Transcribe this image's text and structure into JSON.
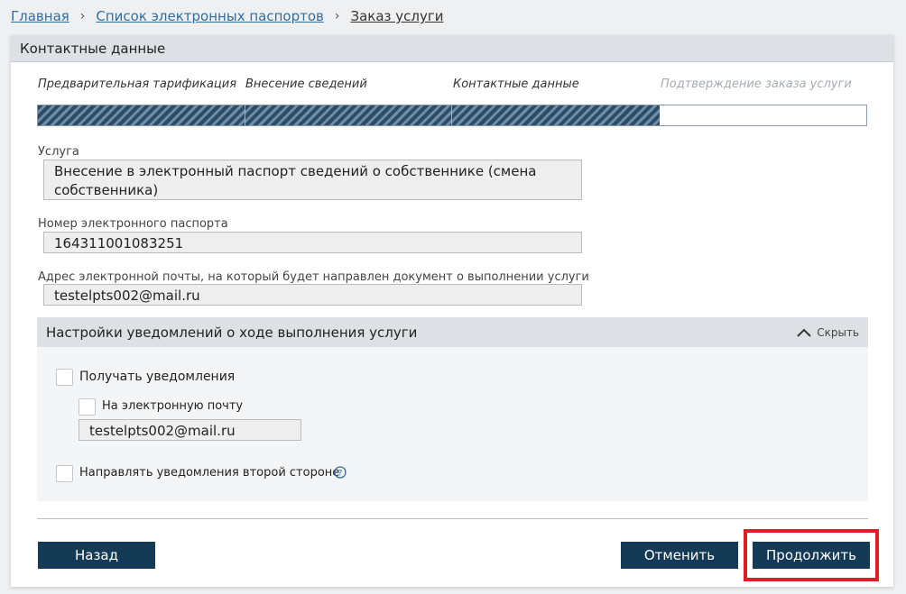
{
  "breadcrumb": {
    "home": "Главная",
    "passports": "Список электронных паспортов",
    "current": "Заказ услуги"
  },
  "panel": {
    "title": "Контактные данные"
  },
  "steps": [
    {
      "label": "Предварительная тарификация",
      "completed": true
    },
    {
      "label": "Внесение сведений",
      "completed": true
    },
    {
      "label": "Контактные данные",
      "completed": true
    },
    {
      "label": "Подтверждение заказа услуги",
      "completed": false
    }
  ],
  "form": {
    "service_label": "Услуга",
    "service_value": "Внесение в электронный паспорт сведений о собственнике (смена собственника)",
    "passport_label": "Номер электронного паспорта",
    "passport_value": "164311001083251",
    "email_label": "Адрес электронной почты, на который будет направлен документ о выполнении услуги",
    "email_value": "testelpts002@mail.ru"
  },
  "notifications": {
    "title": "Настройки уведомлений о ходе выполнения услуги",
    "hide_label": "Скрыть",
    "receive_label": "Получать уведомления",
    "receive_checked": false,
    "email_option_label": "На электронную почту",
    "email_option_checked": false,
    "email_value": "testelpts002@mail.ru",
    "second_party_label": "Направлять уведомления второй стороне",
    "second_party_checked": false
  },
  "buttons": {
    "back": "Назад",
    "cancel": "Отменить",
    "continue": "Продолжить"
  },
  "colors": {
    "button_bg": "#153a56",
    "link": "#2f6ea3",
    "highlight": "#e01c24",
    "progress_fill": "#314b63"
  }
}
